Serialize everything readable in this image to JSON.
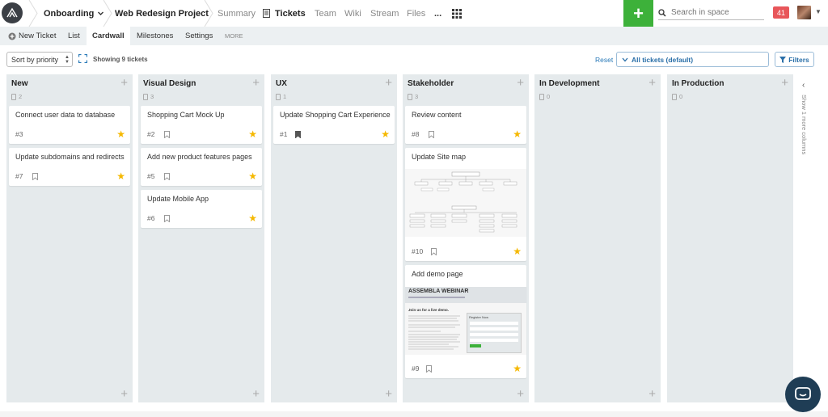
{
  "topbar": {
    "breadcrumb": [
      {
        "label": "Onboarding"
      },
      {
        "label": "Web Redesign Project"
      }
    ],
    "nav": [
      {
        "label": "Summary",
        "active": false
      },
      {
        "label": "Tickets",
        "active": true
      },
      {
        "label": "Team",
        "active": false
      },
      {
        "label": "Wiki",
        "active": false
      },
      {
        "label": "Stream",
        "active": false
      },
      {
        "label": "Files",
        "active": false
      },
      {
        "label": "...",
        "active": false
      }
    ],
    "add_label": "+",
    "search_placeholder": "Search in space",
    "notification_count": "41"
  },
  "subnav": {
    "new_ticket": "New Ticket",
    "list": "List",
    "cardwall": "Cardwall",
    "milestones": "Milestones",
    "settings": "Settings",
    "more": "MORE"
  },
  "toolbar": {
    "sort_label": "Sort by priority",
    "showing": "Showing 9 tickets",
    "reset": "Reset",
    "tickets_filter": "All tickets (default)",
    "filters": "Filters"
  },
  "columns": [
    {
      "title": "New",
      "count": "2",
      "cards": [
        {
          "title": "Connect user data to database",
          "num": "#3",
          "bookmark": false,
          "star": true
        },
        {
          "title": "Update subdomains and redirects",
          "num": "#7",
          "bookmark": true,
          "star": true
        }
      ]
    },
    {
      "title": "Visual Design",
      "count": "3",
      "cards": [
        {
          "title": "Shopping Cart Mock Up",
          "num": "#2",
          "bookmark": true,
          "star": true
        },
        {
          "title": "Add new product features pages",
          "num": "#5",
          "bookmark": true,
          "star": true
        },
        {
          "title": "Update Mobile App",
          "num": "#6",
          "bookmark": true,
          "star": true
        }
      ]
    },
    {
      "title": "UX",
      "count": "1",
      "cards": [
        {
          "title": "Update Shopping Cart Experience",
          "num": "#1",
          "bookmark": "filled",
          "star": true
        }
      ]
    },
    {
      "title": "Stakeholder",
      "count": "3",
      "cards": [
        {
          "title": "Review content",
          "num": "#8",
          "bookmark": true,
          "star": true
        },
        {
          "title": "Update Site map",
          "num": "#10",
          "bookmark": true,
          "star": true,
          "thumbnail": "sitemap"
        },
        {
          "title": "Add demo page",
          "num": "#9",
          "bookmark": true,
          "star": true,
          "thumbnail": "webinar"
        }
      ]
    },
    {
      "title": "In Development",
      "count": "0",
      "cards": []
    },
    {
      "title": "In Production",
      "count": "0",
      "cards": []
    }
  ],
  "webinar_thumb": {
    "heading": "ASSEMBLA WEBINAR",
    "subheading": "Join us for a live demo.",
    "form_title": "Register Now"
  },
  "show_more_columns": "Show 1 more columns",
  "colors": {
    "accent_green": "#3db13a",
    "link_blue": "#2a7ab8",
    "star": "#f5b800",
    "column_bg": "#e5eaec",
    "badge_red": "#e8565a"
  }
}
